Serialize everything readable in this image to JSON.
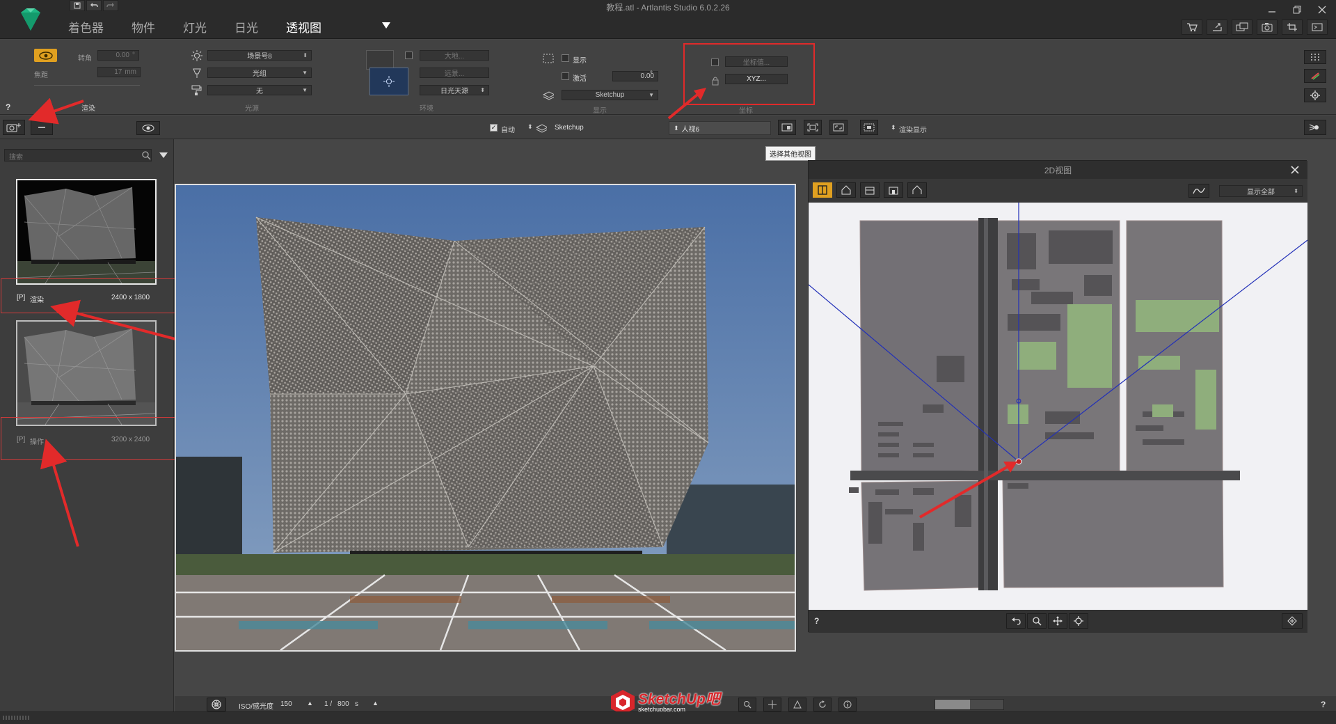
{
  "window": {
    "title": "教程.atl - Artlantis Studio 6.0.2.26"
  },
  "menu": {
    "items": [
      "着色器",
      "物件",
      "灯光",
      "日光",
      "透视图"
    ],
    "active_index": 4
  },
  "params": {
    "camera": {
      "roll_label": "转角",
      "roll_value": "0.00",
      "roll_unit": "°",
      "focal_label": "焦距",
      "focal_value": "17",
      "focal_unit": "mm",
      "section": "渲染"
    },
    "lighting": {
      "scene": "场景号8",
      "light": "光组",
      "none": "无",
      "section": "光源"
    },
    "environment": {
      "field1": "大地...",
      "field2": "远景...",
      "sky": "日光天源",
      "section": "环境"
    },
    "display": {
      "show": "显示",
      "activate": "激活",
      "angle": "0.00",
      "angle_unit": "°",
      "layer": "Sketchup",
      "section": "显示"
    },
    "coords": {
      "field1": "坐标值...",
      "xyz": "XYZ...",
      "section": "坐标"
    },
    "help": "?"
  },
  "toolbar2": {
    "auto_label": "自动",
    "layer": "Sketchup",
    "view_select": "人视6",
    "render_display": "渲染显示",
    "tooltip": "选择其他视图"
  },
  "sidebar": {
    "search_placeholder": "搜索",
    "items": [
      {
        "tag": "[P]",
        "name": "渲染",
        "size": "2400 x 1800"
      },
      {
        "tag": "[P]",
        "name": "操作",
        "size": "3200 x 2400"
      }
    ]
  },
  "view2d": {
    "title": "2D视图",
    "dropdown": "显示全部",
    "help": "?"
  },
  "status": {
    "iso_label": "ISO/感光度",
    "iso_value": "150",
    "shutter_prefix": "1 /",
    "shutter_value": "800",
    "shutter_unit": "s",
    "help": "?"
  },
  "watermark": {
    "brand": "SketchUp吧",
    "url": "sketchupbar.com"
  },
  "colors": {
    "accent": "#e0a020",
    "annotation_red": "#e02a2a",
    "map_bg": "#f1f1f4",
    "building": "#6e6e6e",
    "grass": "#8db07a"
  }
}
